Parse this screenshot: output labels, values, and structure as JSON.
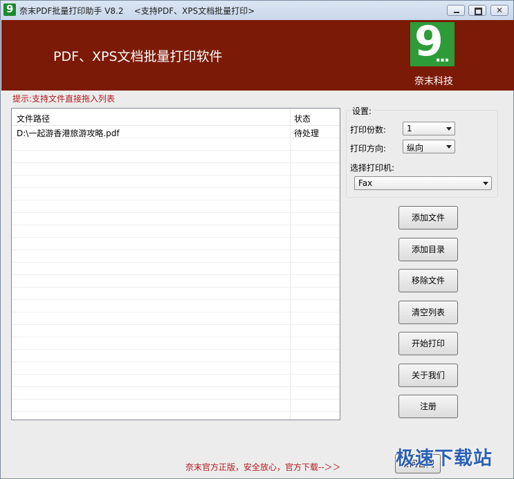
{
  "window": {
    "title": "奈末PDF批量打印助手 V8.2    <支持PDF、XPS文档批量打印>",
    "app_icon_glyph": "9",
    "controls": {
      "minimize": "minimize",
      "maximize": "maximize",
      "close": "✕"
    }
  },
  "banner": {
    "title": "PDF、XPS文档批量打印软件",
    "logo_digit": "9",
    "logo_dots": "...",
    "brand_name": "奈末科技",
    "background_color": "#7c1a08",
    "logo_color": "#2e9b39"
  },
  "hint": "提示:支持文件直接拖入列表",
  "file_list": {
    "columns": [
      "文件路径",
      "状态"
    ],
    "rows": [
      {
        "path": "D:\\一起游香港旅游攻略.pdf",
        "status": "待处理"
      }
    ]
  },
  "settings": {
    "title": "设置:",
    "copies_label": "打印份数:",
    "copies_value": "1",
    "orientation_label": "打印方向:",
    "orientation_value": "纵向",
    "printer_label": "选择打印机:",
    "printer_value": "Fax"
  },
  "buttons": {
    "add_file": "添加文件",
    "add_dir": "添加目录",
    "remove_file": "移除文件",
    "clear_list": "清空列表",
    "start_print": "开始打印",
    "about": "关于我们",
    "register": "注册"
  },
  "footer": {
    "text": "奈末官方正版，安全放心，官方下载--＞＞",
    "visit_button": "访问官网",
    "accent_color": "#b0191e"
  },
  "watermark": "极速下载站"
}
